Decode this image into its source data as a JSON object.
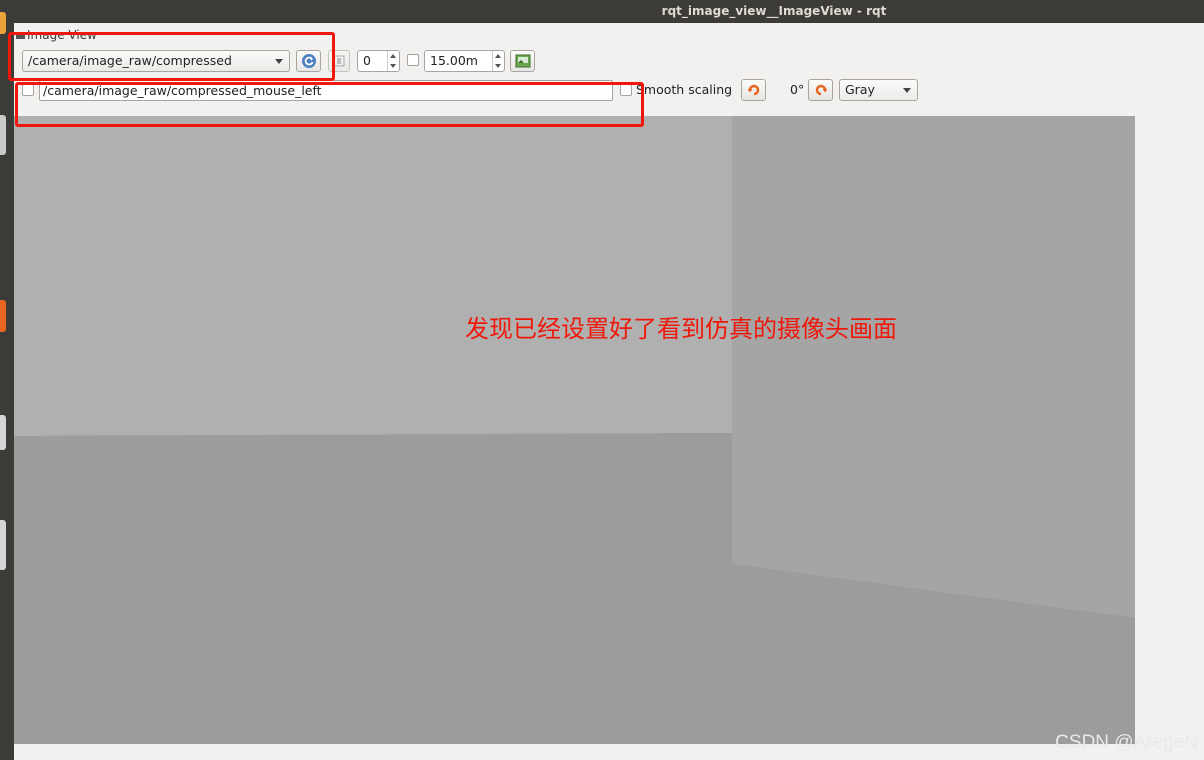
{
  "window": {
    "title": "rqt_image_view__ImageView - rqt"
  },
  "dock": {
    "title": "Image View"
  },
  "toolbar": {
    "topic_value": "/camera/image_raw/compressed",
    "spin_value": "0",
    "max_depth_value": "15.00m"
  },
  "row2": {
    "mouse_topic_value": "/camera/image_raw/compressed_mouse_left",
    "smooth_label": "Smooth scaling",
    "rotation_value": "0°",
    "color_mode_value": "Gray"
  },
  "annotation": {
    "text": "发现已经设置好了看到仿真的摄像头画面",
    "color": "#f0180a"
  },
  "watermark": "CSDN @AregeN",
  "colors": {
    "launcher": "#3c3b37",
    "window_bg": "#f2f1f0",
    "accent_orange": "#e8661f",
    "refresh_blue": "#4a7fbf"
  }
}
